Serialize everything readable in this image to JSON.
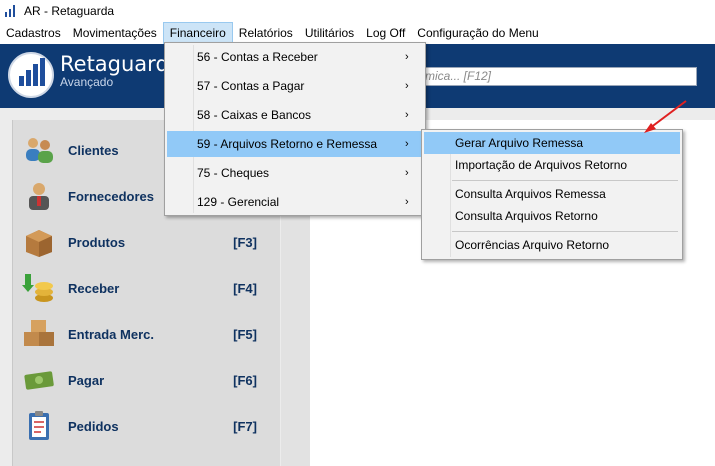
{
  "window": {
    "title": "AR - Retaguarda"
  },
  "menubar": {
    "items": [
      "Cadastros",
      "Movimentações",
      "Financeiro",
      "Relatórios",
      "Utilitários",
      "Log Off",
      "Configuração do Menu"
    ],
    "active": "Financeiro"
  },
  "header": {
    "brand": "Retaguarda",
    "subtitle": "Avançado",
    "search_text": "mica... [F12]"
  },
  "sidebar": {
    "items": [
      {
        "label": "Clientes",
        "key": "",
        "icon": "clients-icon"
      },
      {
        "label": "Fornecedores",
        "key": "",
        "icon": "supplier-icon"
      },
      {
        "label": "Produtos",
        "key": "[F3]",
        "icon": "box-icon"
      },
      {
        "label": "Receber",
        "key": "[F4]",
        "icon": "coins-icon"
      },
      {
        "label": "Entrada Merc.",
        "key": "[F5]",
        "icon": "boxes-icon"
      },
      {
        "label": "Pagar",
        "key": "[F6]",
        "icon": "money-icon"
      },
      {
        "label": "Pedidos",
        "key": "[F7]",
        "icon": "clipboard-icon"
      }
    ]
  },
  "financeiro_menu": {
    "items": [
      "56 - Contas a Receber",
      "57 - Contas a Pagar",
      "58 - Caixas e Bancos",
      "59 - Arquivos Retorno e Remessa",
      "75 - Cheques",
      "129 - Gerencial"
    ],
    "arrow": "›"
  },
  "arquivos_submenu": {
    "items": [
      "Gerar Arquivo Remessa",
      "Importação de Arquivos Retorno",
      "Consulta Arquivos Remessa",
      "Consulta Arquivos Retorno",
      "Ocorrências Arquivo Retorno"
    ]
  },
  "colors": {
    "header_bg": "#0e3a73",
    "highlight": "#91c9f7",
    "sidebar_text": "#0f3260",
    "annotation_arrow": "#e02020"
  }
}
